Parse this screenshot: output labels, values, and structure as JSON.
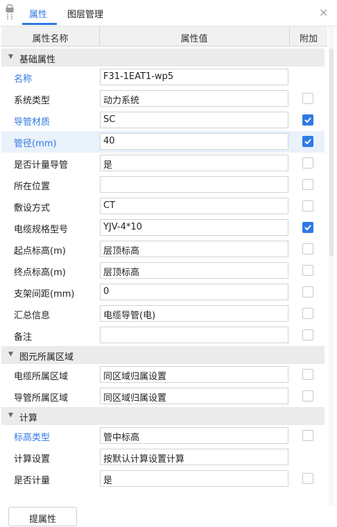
{
  "tabs": [
    {
      "label": "属性"
    },
    {
      "label": "图层管理"
    }
  ],
  "columns": {
    "name": "属性名称",
    "value": "属性值",
    "extra": "附加"
  },
  "groups": [
    {
      "label": "基础属性",
      "rows": [
        {
          "name": "名称",
          "value": "F31-1EAT1-wp5",
          "checked": null,
          "blue": true
        },
        {
          "name": "系统类型",
          "value": "动力系统",
          "checked": false,
          "blue": false
        },
        {
          "name": "导管材质",
          "value": "SC",
          "checked": true,
          "blue": true
        },
        {
          "name": "管径(mm)",
          "value": "40",
          "checked": true,
          "blue": true
        },
        {
          "name": "是否计量导管",
          "value": "是",
          "checked": false,
          "blue": false
        },
        {
          "name": "所在位置",
          "value": "",
          "checked": false,
          "blue": false
        },
        {
          "name": "敷设方式",
          "value": "CT",
          "checked": false,
          "blue": false
        },
        {
          "name": "电缆规格型号",
          "value": "YJV-4*10",
          "checked": true,
          "blue": false
        },
        {
          "name": "起点标高(m)",
          "value": "层顶标高",
          "checked": false,
          "blue": false
        },
        {
          "name": "终点标高(m)",
          "value": "层顶标高",
          "checked": false,
          "blue": false
        },
        {
          "name": "支架间距(mm)",
          "value": "0",
          "checked": false,
          "blue": false
        },
        {
          "name": "汇总信息",
          "value": "电缆导管(电)",
          "checked": false,
          "blue": false
        },
        {
          "name": "备注",
          "value": "",
          "checked": false,
          "blue": false
        }
      ]
    },
    {
      "label": "图元所属区域",
      "rows": [
        {
          "name": "电缆所属区域",
          "value": "同区域归属设置",
          "checked": false,
          "blue": false
        },
        {
          "name": "导管所属区域",
          "value": "同区域归属设置",
          "checked": false,
          "blue": false
        }
      ]
    },
    {
      "label": "计算",
      "rows": [
        {
          "name": "标高类型",
          "value": "管中标高",
          "checked": false,
          "blue": true
        },
        {
          "name": "计算设置",
          "value": "按默认计算设置计算",
          "checked": null,
          "blue": false
        },
        {
          "name": "是否计量",
          "value": "是",
          "checked": false,
          "blue": false
        }
      ]
    }
  ],
  "footer": {
    "button_label": "提属性"
  },
  "colors": {
    "accent": "#2f7ae5",
    "group_bg": "#ebebeb",
    "highlight_row": "#e9f1fb"
  }
}
